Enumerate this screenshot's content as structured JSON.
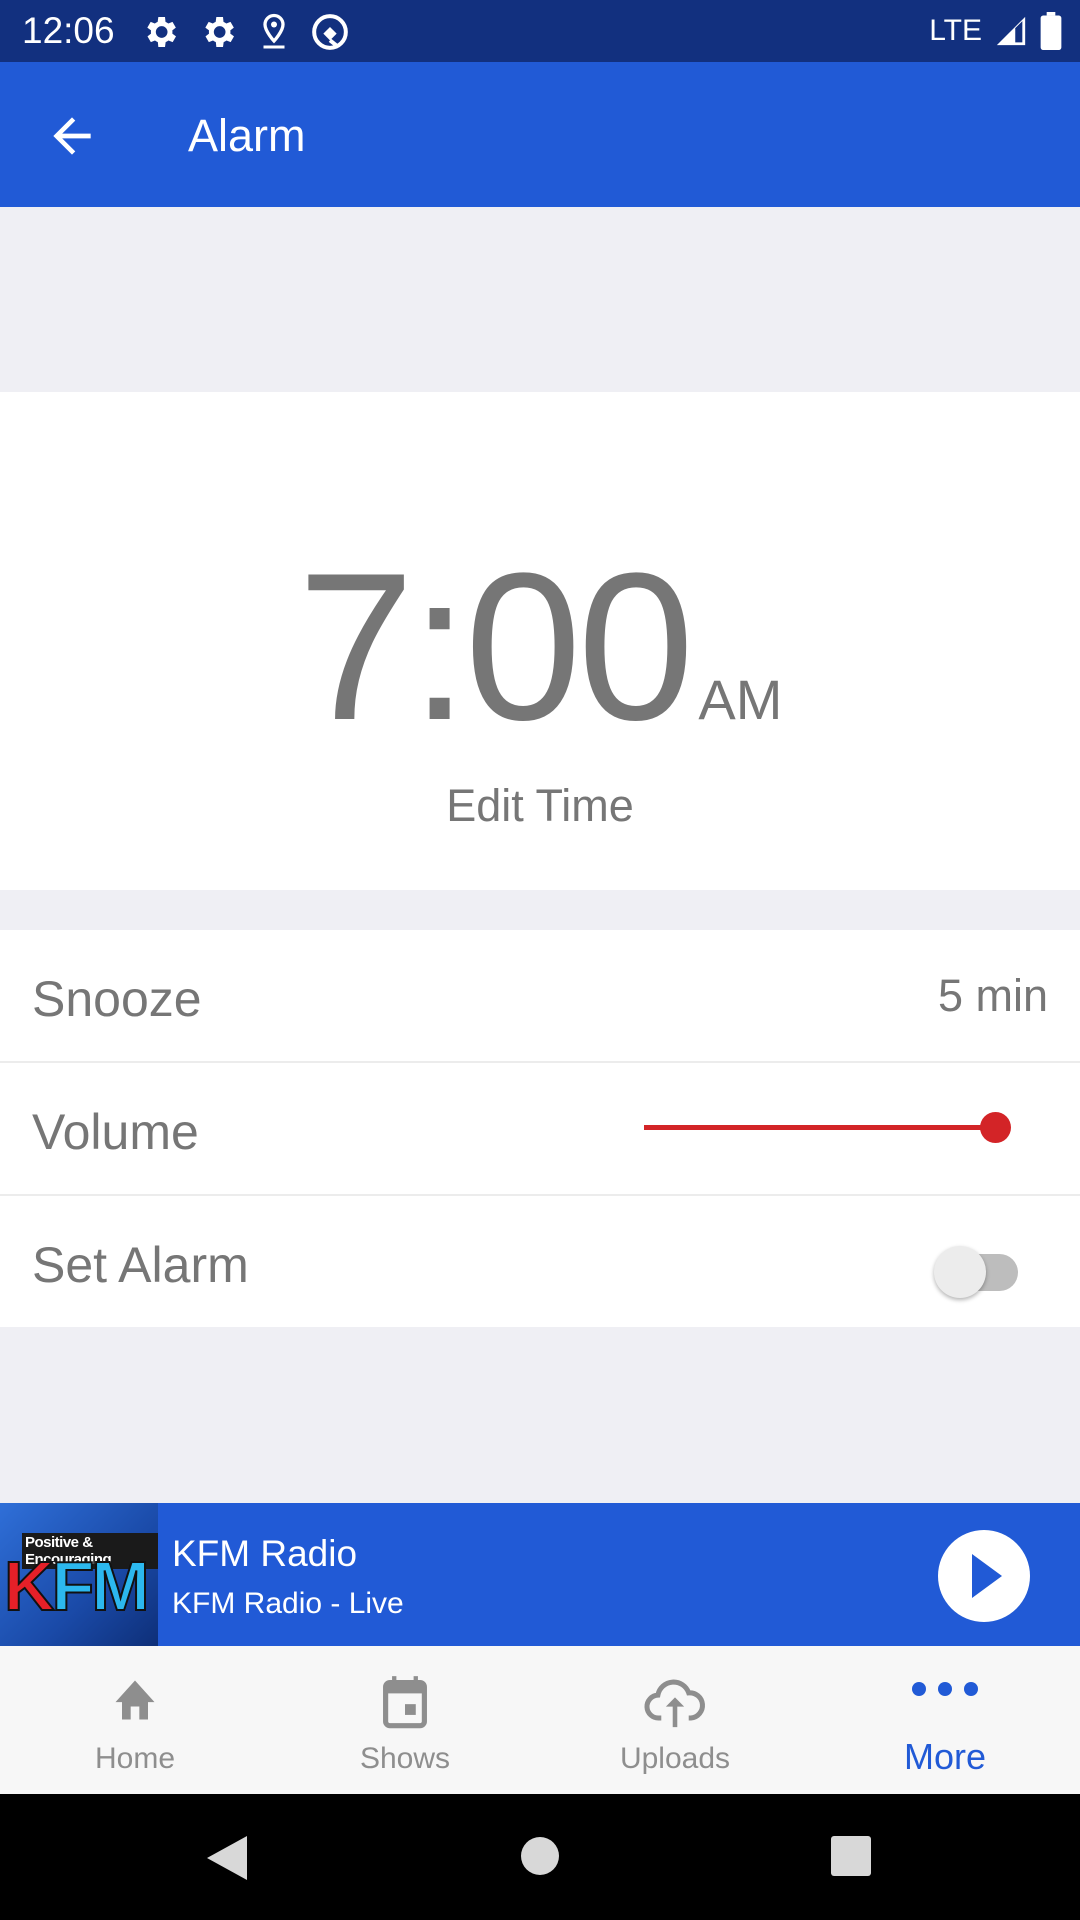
{
  "status_bar": {
    "time": "12:06",
    "left_icons": [
      "settings-icon",
      "settings-icon",
      "location-icon",
      "vpn-icon"
    ],
    "network": "LTE",
    "right_icons": [
      "signal-icon",
      "battery-icon"
    ]
  },
  "app_bar": {
    "back_icon": "arrow-back-icon",
    "title": "Alarm"
  },
  "alarm": {
    "time": "7:00",
    "ampm": "AM",
    "edit_label": "Edit Time"
  },
  "settings": {
    "snooze": {
      "label": "Snooze",
      "value": "5 min"
    },
    "volume": {
      "label": "Volume",
      "level": 0.96
    },
    "set_alarm": {
      "label": "Set Alarm",
      "enabled": false
    }
  },
  "player": {
    "artwork": {
      "tagline": "Positive & Encouraging",
      "logo_k": "K",
      "logo_fm": "FM"
    },
    "title": "KFM Radio",
    "subtitle": "KFM Radio - Live",
    "play_icon": "play-icon"
  },
  "tabs": [
    {
      "label": "Home",
      "icon": "home-icon",
      "active": false
    },
    {
      "label": "Shows",
      "icon": "calendar-icon",
      "active": false
    },
    {
      "label": "Uploads",
      "icon": "cloud-upload-icon",
      "active": false
    },
    {
      "label": "More",
      "icon": "more-dots-icon",
      "active": true
    }
  ],
  "colors": {
    "status_bar": "#12307f",
    "primary": "#215ad6",
    "slider": "#d32427",
    "text_gray": "#767676",
    "inactive_tab": "#8e8e8e"
  }
}
